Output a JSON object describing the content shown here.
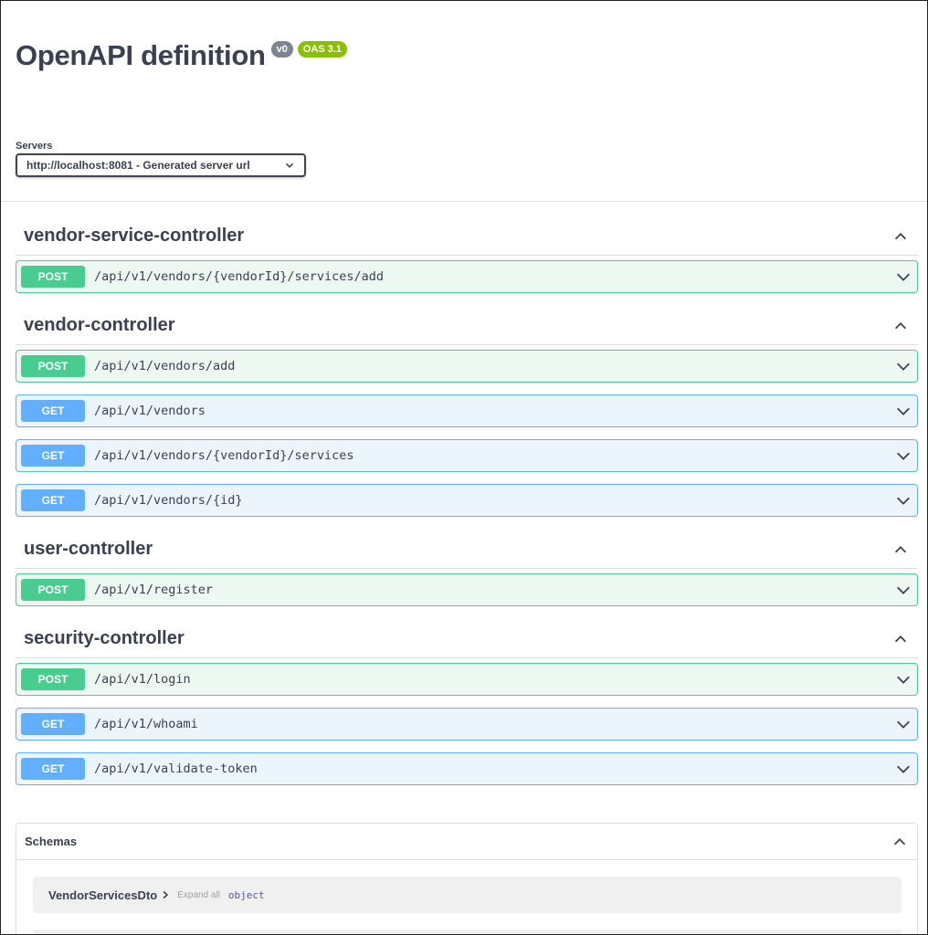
{
  "header": {
    "title": "OpenAPI definition",
    "version_badge": "v0",
    "oas_badge": "OAS 3.1"
  },
  "servers": {
    "label": "Servers",
    "selected": "http://localhost:8081 - Generated server url"
  },
  "colors": {
    "post": "#49cc90",
    "get": "#61affe",
    "oas_badge": "#89bf04",
    "version_badge": "#7d8492"
  },
  "tags": [
    {
      "name": "vendor-service-controller",
      "operations": [
        {
          "method": "POST",
          "path": "/api/v1/vendors/{vendorId}/services/add"
        }
      ]
    },
    {
      "name": "vendor-controller",
      "operations": [
        {
          "method": "POST",
          "path": "/api/v1/vendors/add"
        },
        {
          "method": "GET",
          "path": "/api/v1/vendors"
        },
        {
          "method": "GET",
          "path": "/api/v1/vendors/{vendorId}/services"
        },
        {
          "method": "GET",
          "path": "/api/v1/vendors/{id}"
        }
      ]
    },
    {
      "name": "user-controller",
      "operations": [
        {
          "method": "POST",
          "path": "/api/v1/register"
        }
      ]
    },
    {
      "name": "security-controller",
      "operations": [
        {
          "method": "POST",
          "path": "/api/v1/login"
        },
        {
          "method": "GET",
          "path": "/api/v1/whoami"
        },
        {
          "method": "GET",
          "path": "/api/v1/validate-token"
        }
      ]
    }
  ],
  "schemas": {
    "title": "Schemas",
    "models": [
      {
        "name": "VendorServicesDto",
        "expand_label": "Expand all",
        "type": "object"
      }
    ]
  }
}
